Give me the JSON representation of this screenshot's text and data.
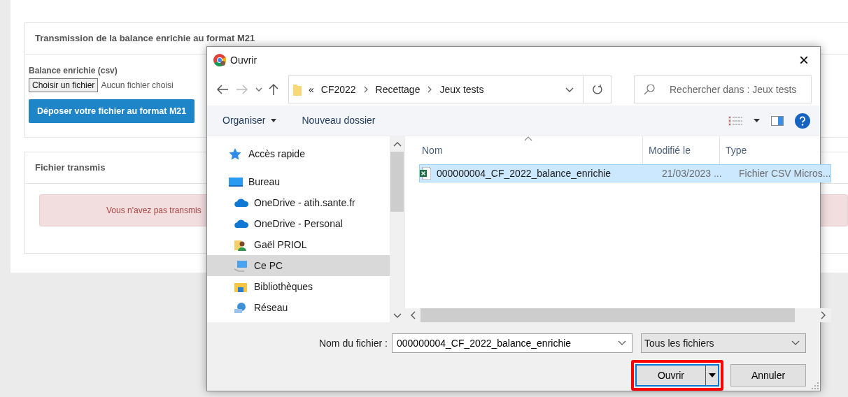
{
  "panels": [
    {
      "title": "Transmission de la balance enrichie au format M21",
      "field_label": "Balance enrichie (csv)",
      "file_button": "Choisir un fichier",
      "file_status": "Aucun fichier choisi",
      "submit": "Déposer votre fichier au format M21"
    },
    {
      "title": "Fichier transmis",
      "alert": "Vous n'avez pas transmis"
    }
  ],
  "dialog": {
    "title": "Ouvrir",
    "close": "×",
    "breadcrumb": {
      "overflow": "«",
      "parts": [
        "CF2022",
        "Recettage",
        "Jeux tests"
      ]
    },
    "search": {
      "placeholder": "Rechercher dans : Jeux tests"
    },
    "toolbar": [
      {
        "label": "Organiser",
        "dropdown": true
      },
      {
        "label": "Nouveau dossier",
        "dropdown": false
      }
    ],
    "nav": [
      {
        "label": "Accès rapide",
        "kind": "star",
        "selected": false
      },
      {
        "label": "Bureau",
        "kind": "desktop",
        "selected": false,
        "children": [
          {
            "label": "OneDrive - atih.sante.fr",
            "kind": "cloud",
            "selected": false
          },
          {
            "label": "OneDrive - Personal",
            "kind": "cloud",
            "selected": false
          },
          {
            "label": "Gaël PRIOL",
            "kind": "user",
            "selected": false
          },
          {
            "label": "Ce PC",
            "kind": "pc",
            "selected": true
          },
          {
            "label": "Bibliothèques",
            "kind": "library",
            "selected": false
          },
          {
            "label": "Réseau",
            "kind": "network",
            "selected": false
          }
        ]
      }
    ],
    "columns": [
      "Nom",
      "Modifié le",
      "Type"
    ],
    "files": [
      {
        "name": "000000004_CF_2022_balance_enrichie",
        "modified": "21/03/2023 ...",
        "type": "Fichier CSV Micros...",
        "selected": true
      }
    ],
    "filename_label": "Nom du fichier :",
    "filename": "000000004_CF_2022_balance_enrichie",
    "filter": "Tous les fichiers",
    "buttons": [
      {
        "label": "Ouvrir",
        "kind": "split",
        "highlighted": true
      },
      {
        "label": "Annuler",
        "kind": "plain",
        "highlighted": false
      }
    ]
  }
}
